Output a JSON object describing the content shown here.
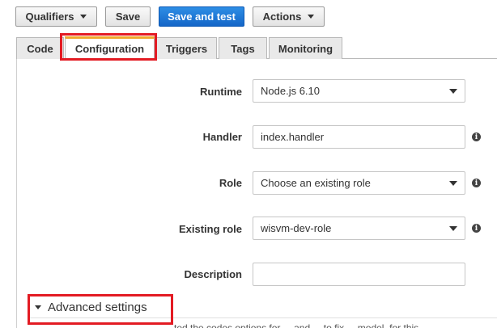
{
  "toolbar": {
    "qualifiers_label": "Qualifiers",
    "save_label": "Save",
    "save_and_test_label": "Save and test",
    "actions_label": "Actions"
  },
  "tabs": [
    {
      "label": "Code"
    },
    {
      "label": "Configuration",
      "active": true
    },
    {
      "label": "Triggers"
    },
    {
      "label": "Tags"
    },
    {
      "label": "Monitoring"
    }
  ],
  "form": {
    "runtime": {
      "label": "Runtime",
      "value": "Node.js 6.10"
    },
    "handler": {
      "label": "Handler",
      "value": "index.handler"
    },
    "role": {
      "label": "Role",
      "value": "Choose an existing role"
    },
    "existing_role": {
      "label": "Existing role",
      "value": "wisvm-dev-role"
    },
    "description": {
      "label": "Description",
      "value": ""
    }
  },
  "advanced_settings_label": "Advanced settings",
  "cut_off_text": "ted the codes options for ... and ... to fix ... model, for this",
  "icons": {
    "info": "info-icon",
    "caret": "chevron-down-icon"
  },
  "colors": {
    "primary": "#1a73d1",
    "highlight": "#e31b23",
    "active_tab_accent": "#f0a72e"
  }
}
